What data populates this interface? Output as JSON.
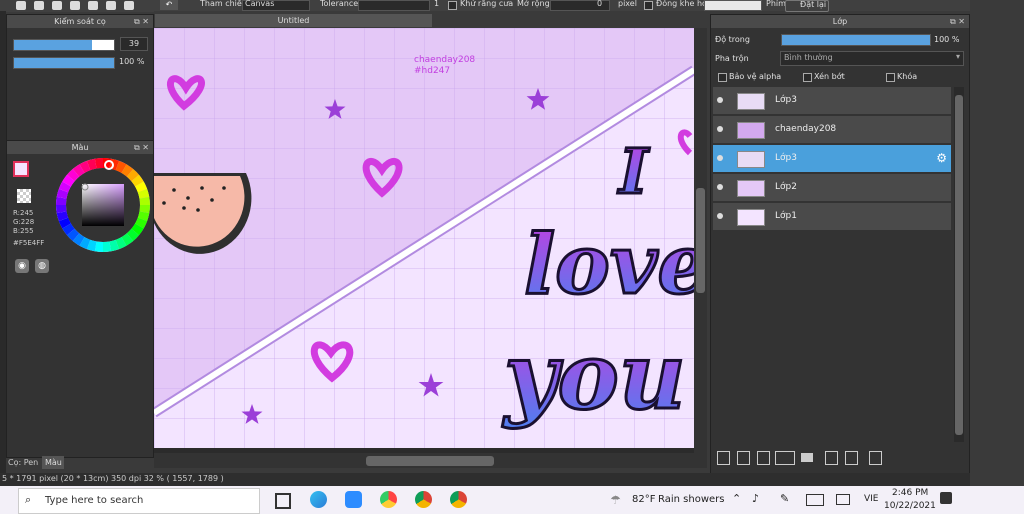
{
  "toolbar": {
    "reference_label": "Tham chiếu",
    "reference_value": "Canvas",
    "tolerance_label": "Tolerance",
    "tolerance_value": "1",
    "antialias_label": "Khử răng cưa",
    "expand_label": "Mở rộng",
    "expand_value": "0",
    "expand_unit": "pixel",
    "close_gap_label": "Đóng khe hở",
    "key_label": "Phím",
    "reset_label": "Đặt lại"
  },
  "brush_panel": {
    "title": "Kiểm soát cọ",
    "size_value": "39",
    "size_fraction": 0.78,
    "opacity_value": "100 %",
    "opacity_fraction": 1.0
  },
  "color_panel": {
    "title": "Màu",
    "r": "R:245",
    "g": "G:228",
    "b": "B:255",
    "hex": "#F5E4FF",
    "tab_pen": "Cọ: Pen",
    "tab_color": "Màu"
  },
  "canvas": {
    "tab_title": "Untitled",
    "watermark_line1": "chaenday208",
    "watermark_line2": "#hd247",
    "lettering": [
      "I",
      "love",
      "you"
    ]
  },
  "layer_panel": {
    "title": "Lớp",
    "opacity_label": "Độ trong",
    "opacity_value": "100 %",
    "opacity_fraction": 1.0,
    "blend_label": "Pha trộn",
    "blend_value": "Bình thường",
    "protect_alpha": "Bảo vệ alpha",
    "clipping": "Xén bớt",
    "lock": "Khóa",
    "layers": [
      {
        "name": "Lớp3",
        "selected": false
      },
      {
        "name": "chaenday208",
        "selected": false
      },
      {
        "name": "Lớp3",
        "selected": true
      },
      {
        "name": "Lớp2",
        "selected": false
      },
      {
        "name": "Lớp1",
        "selected": false
      }
    ]
  },
  "status": {
    "text": "5 * 1791 pixel   (20 * 13cm)   350 dpi   32 %   ( 1557, 1789 )"
  },
  "taskbar": {
    "search_placeholder": "Type here to search",
    "weather_temp": "82°F",
    "weather_desc": "Rain showers",
    "lang": "VIE",
    "time": "2:46 PM",
    "date": "10/22/2021"
  },
  "colors": {
    "accent": "#4aa0dc",
    "canvas_lilac": "#e4c8f7",
    "canvas_pale": "#f3e4ff",
    "heart_magenta": "#d23ce0",
    "star_purple": "#9b3fd8",
    "letter_gradient_top": "#c23ee0",
    "letter_gradient_bottom": "#4e7ff0"
  }
}
